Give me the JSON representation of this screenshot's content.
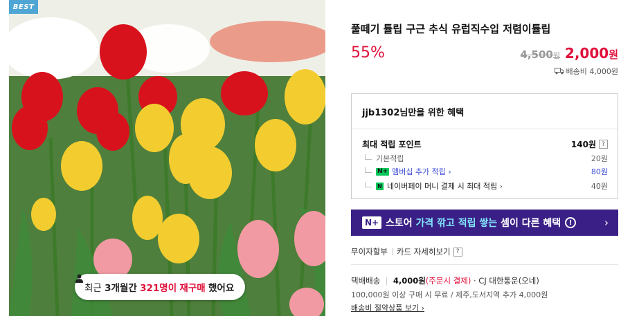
{
  "badge": {
    "best": "BEST"
  },
  "repurchase": {
    "prefix": "최근",
    "period": "3개월간",
    "count": "321명이",
    "suffix_hl": "재구매",
    "suffix": "했어요"
  },
  "product": {
    "title": "풀떼기 튤립 구근 추식 유럽직수입 저렴이튤립",
    "discount_rate": "55%",
    "original_price": "4,500",
    "original_unit": "원",
    "sale_price": "2,000",
    "sale_unit": "원",
    "shipping": "배송비 4,000원"
  },
  "benefit": {
    "title": "jjb1302님만을 위한 혜택",
    "max_points_label": "최대 적립 포인트",
    "max_points_value": "140원",
    "rows": [
      {
        "label": "기본적립",
        "value": "20원"
      },
      {
        "badge": "N+",
        "label": "멤버십 추가 적립",
        "value": "80원"
      },
      {
        "badge": "N",
        "label": "네이버페이 머니 결제 시 최대 적립",
        "value": "40원"
      }
    ]
  },
  "banner": {
    "badge": "N+",
    "t1": "스토어",
    "t2": "가격 깎고 적립 쌓는",
    "t3": "셈이 다른 혜택",
    "info": "!",
    "arrow": "›"
  },
  "payment": {
    "installment": "무이자할부",
    "card_detail": "카드 자세히보기",
    "help": "?"
  },
  "delivery": {
    "type": "택배배송",
    "fee": "4,000원",
    "fee_note": "(주문시 결제)",
    "carrier": "· CJ 대한통운(오네)",
    "conditions": "100,000원 이상 구매 시 무료 / 제주,도서지역 추가 4,000원",
    "saving_link": "배송비 절약상품 보기"
  },
  "colors": {
    "accent_red": "#e0103a",
    "banner_bg": "#3a2086",
    "banner_accent": "#82e6ff",
    "naver_green": "#03c75a",
    "link_blue": "#3b4bd6"
  }
}
